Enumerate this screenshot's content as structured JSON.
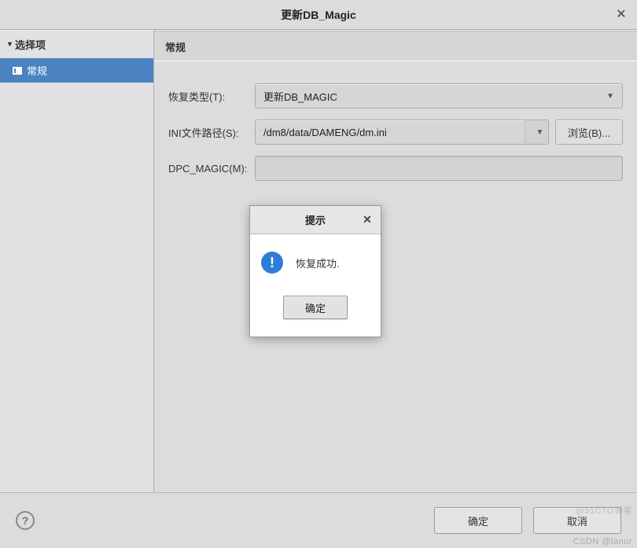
{
  "window": {
    "title": "更新DB_Magic"
  },
  "sidebar": {
    "header": "选择项",
    "items": [
      {
        "label": "常规"
      }
    ]
  },
  "content": {
    "header": "常规",
    "fields": {
      "recover_type": {
        "label": "恢复类型(T):",
        "value": "更新DB_MAGIC"
      },
      "ini_path": {
        "label": "INI文件路径(S):",
        "value": "/dm8/data/DAMENG/dm.ini",
        "browse": "浏览(B)..."
      },
      "dpc_magic": {
        "label": "DPC_MAGIC(M):",
        "value": ""
      }
    }
  },
  "modal": {
    "title": "提示",
    "message": "恢复成功.",
    "ok": "确定"
  },
  "footer": {
    "ok": "确定",
    "cancel": "取消"
  },
  "watermark": "CSDN @lanur",
  "watermark2": "@51CTO博客"
}
